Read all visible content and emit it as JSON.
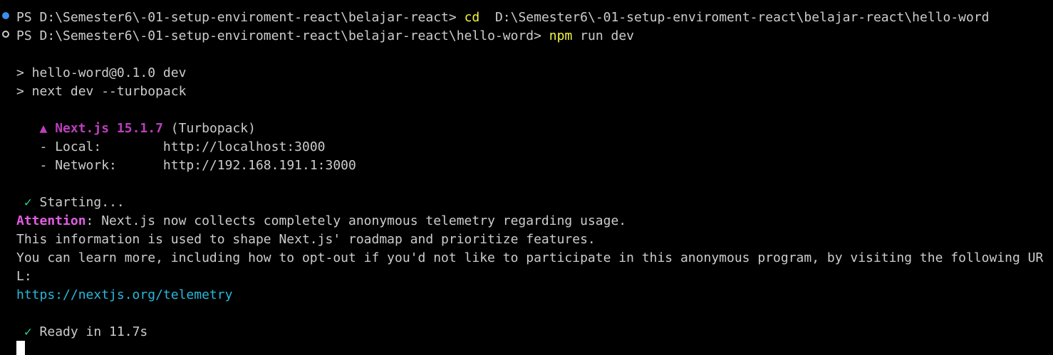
{
  "prompt": {
    "ps": "PS",
    "path1": "D:\\Semester6\\-01-setup-enviroment-react\\belajar-react>",
    "cmd1": "cd",
    "arg1": "D:\\Semester6\\-01-setup-enviroment-react\\belajar-react\\hello-word",
    "path2": "D:\\Semester6\\-01-setup-enviroment-react\\belajar-react\\hello-word>",
    "cmd2": "npm",
    "arg2": "run dev"
  },
  "script": {
    "line1": "> hello-word@0.1.0 dev",
    "line2": "> next dev --turbopack"
  },
  "next": {
    "triangle": "▲",
    "name": "Next.js 15.1.7",
    "mode": "(Turbopack)",
    "local_label": "- Local:",
    "local_url": "http://localhost:3000",
    "network_label": "- Network:",
    "network_url": "http://192.168.191.1:3000"
  },
  "status": {
    "check": "✓",
    "starting": "Starting...",
    "ready": "Ready in 11.7s"
  },
  "telemetry": {
    "attention": "Attention",
    "attention_rest": ": Next.js now collects completely anonymous telemetry regarding usage.",
    "info": "This information is used to shape Next.js' roadmap and prioritize features.",
    "learn": "You can learn more, including how to opt-out if you'd not like to participate in this anonymous program, by visiting the following UR",
    "learn_wrap": "L:",
    "url": "https://nextjs.org/telemetry"
  },
  "colors": {
    "background": "#000000",
    "text": "#cccccc",
    "command": "#f5f543",
    "attention": "#e05ee0",
    "nextjs": "#bc3fbc",
    "check": "#23d18b",
    "link": "#29b8db",
    "dot_success": "#3b8eea"
  }
}
